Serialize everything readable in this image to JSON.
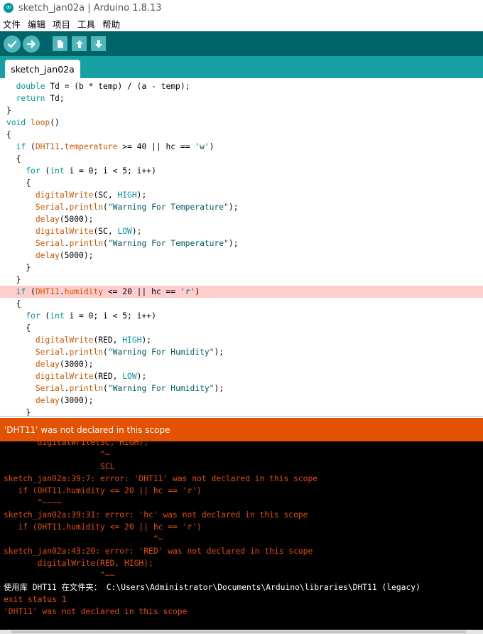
{
  "window": {
    "title": "sketch_jan02a | Arduino 1.8.13",
    "icon": "arduino-logo-icon"
  },
  "menu": {
    "items": [
      "文件",
      "编辑",
      "项目",
      "工具",
      "帮助"
    ]
  },
  "toolbar": {
    "buttons": [
      {
        "name": "verify-button",
        "icon": "check-icon"
      },
      {
        "name": "upload-button",
        "icon": "arrow-right-icon"
      },
      {
        "name": "new-button",
        "icon": "new-file-icon"
      },
      {
        "name": "open-button",
        "icon": "arrow-up-icon"
      },
      {
        "name": "save-button",
        "icon": "arrow-down-icon"
      }
    ]
  },
  "tabs": [
    {
      "label": "sketch_jan02a",
      "active": true
    }
  ],
  "editor": {
    "highlighted_line_index": 17,
    "lines": [
      "  double Td = (b * temp) / (a - temp);",
      "  return Td;",
      "}",
      "void loop()",
      "{",
      "  if (DHT11.temperature >= 40 || hc == 'w')",
      "  {",
      "    for (int i = 0; i < 5; i++)",
      "    {",
      "      digitalWrite(SC, HIGH);",
      "      Serial.println(\"Warning For Temperature\");",
      "      delay(5000);",
      "      digitalWrite(SC, LOW);",
      "      Serial.println(\"Warning For Temperature\");",
      "      delay(5000);",
      "    }",
      "  }",
      "  if (DHT11.humidity <= 20 || hc == 'r')",
      "  {",
      "    for (int i = 0; i < 5; i++)",
      "    {",
      "      digitalWrite(RED, HIGH);",
      "      Serial.println(\"Warning For Humidity\");",
      "      delay(3000);",
      "      digitalWrite(RED, LOW);",
      "      Serial.println(\"Warning For Humidity\");",
      "      delay(3000);",
      "    }"
    ]
  },
  "error_banner": {
    "message": "'DHT11' was not declared in this scope"
  },
  "console": {
    "lines": [
      {
        "text": "       digitalWrite(SC, HIGH);",
        "color": "err"
      },
      {
        "text": "                    ^~",
        "color": "err"
      },
      {
        "text": "                    SCL",
        "color": "err"
      },
      {
        "text": "sketch_jan02a:39:7: error: 'DHT11' was not declared in this scope",
        "color": "err"
      },
      {
        "text": "   if (DHT11.humidity <= 20 || hc == 'r')",
        "color": "err"
      },
      {
        "text": "       ^~~~~",
        "color": "err"
      },
      {
        "text": "sketch_jan02a:39:31: error: 'hc' was not declared in this scope",
        "color": "err"
      },
      {
        "text": "   if (DHT11.humidity <= 20 || hc == 'r')",
        "color": "err"
      },
      {
        "text": "                               ^~",
        "color": "err"
      },
      {
        "text": "sketch_jan02a:43:20: error: 'RED' was not declared in this scope",
        "color": "err"
      },
      {
        "text": "       digitalWrite(RED, HIGH);",
        "color": "err"
      },
      {
        "text": "                    ^~~",
        "color": "err"
      },
      {
        "text": "使用库 DHT11 在文件夹： C:\\Users\\Administrator\\Documents\\Arduino\\libraries\\DHT11 (legacy)",
        "color": "white"
      },
      {
        "text": "exit status 1",
        "color": "err"
      },
      {
        "text": "'DHT11' was not declared in this scope",
        "color": "err"
      }
    ]
  },
  "colors": {
    "toolbar_bg": "#006468",
    "tabbar_bg": "#17a1a5",
    "button_bg": "#4db7bb",
    "error_banner_bg": "#e35200",
    "console_error_text": "#e34c00",
    "highlight_line_bg": "#ffcdcd"
  }
}
